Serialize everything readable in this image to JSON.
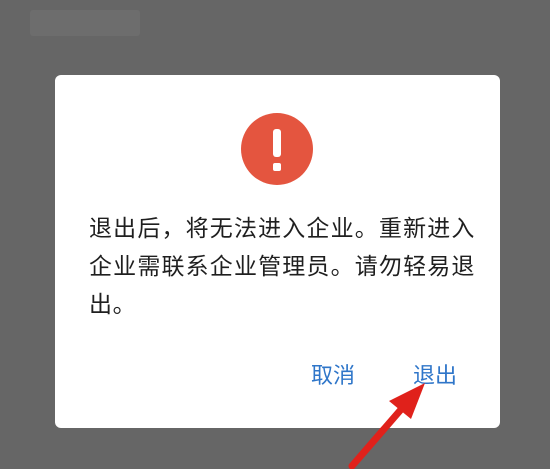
{
  "dialog": {
    "icon": "exclamation-icon",
    "message": "退出后，将无法进入企业。重新进入企业需联系企业管理员。请勿轻易退出。",
    "cancel_label": "取消",
    "exit_label": "退出"
  },
  "colors": {
    "backdrop": "#666666",
    "dialog_background": "#ffffff",
    "alert_red": "#e4553f",
    "button_blue": "#2f76c9",
    "text": "#1f1f1f",
    "annotation_arrow": "#e0211b"
  },
  "annotation": {
    "icon": "red-arrow-icon"
  }
}
